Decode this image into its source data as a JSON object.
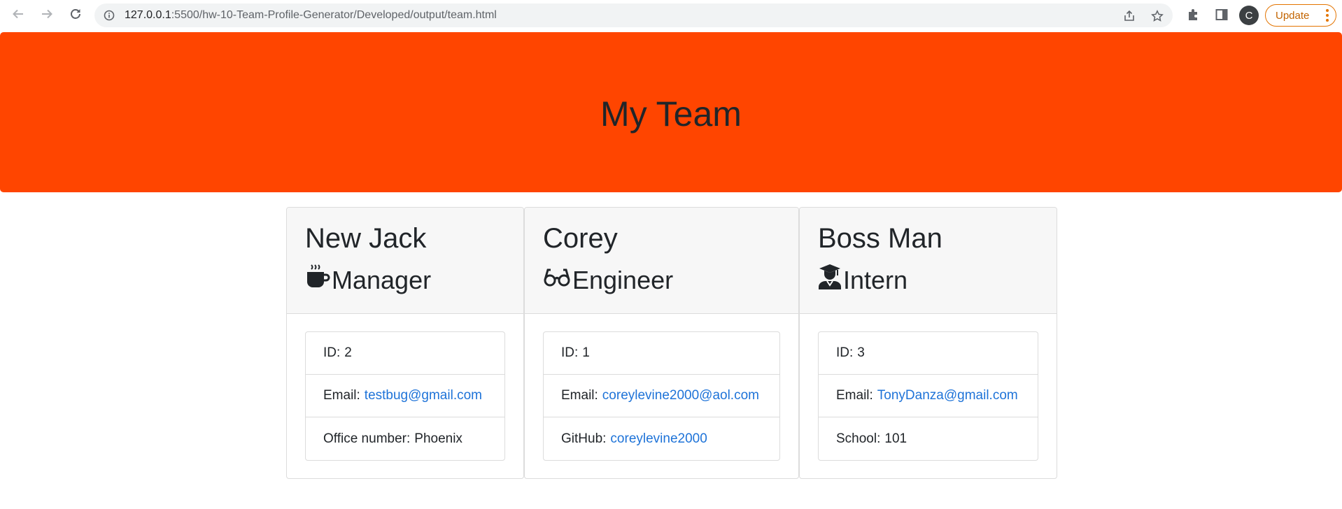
{
  "browser": {
    "url_host": "127.0.0.1",
    "url_rest": ":5500/hw-10-Team-Profile-Generator/Developed/output/team.html",
    "profile_initial": "C",
    "update_label": "Update"
  },
  "header": {
    "title": "My Team",
    "background": "#ff4500"
  },
  "team": [
    {
      "name": "New Jack",
      "role": "Manager",
      "icon": "mug-icon",
      "id_label": "ID:",
      "id": "2",
      "email_label": "Email:",
      "email": "testbug@gmail.com",
      "extra_label": "Office number:",
      "extra_value": "Phoenix"
    },
    {
      "name": "Corey",
      "role": "Engineer",
      "icon": "glasses-icon",
      "id_label": "ID:",
      "id": "1",
      "email_label": "Email:",
      "email": "coreylevine2000@aol.com",
      "extra_label": "GitHub:",
      "extra_value": "coreylevine2000"
    },
    {
      "name": "Boss Man",
      "role": "Intern",
      "icon": "graduate-icon",
      "id_label": "ID:",
      "id": "3",
      "email_label": "Email:",
      "email": "TonyDanza@gmail.com",
      "extra_label": "School:",
      "extra_value": "101"
    }
  ]
}
